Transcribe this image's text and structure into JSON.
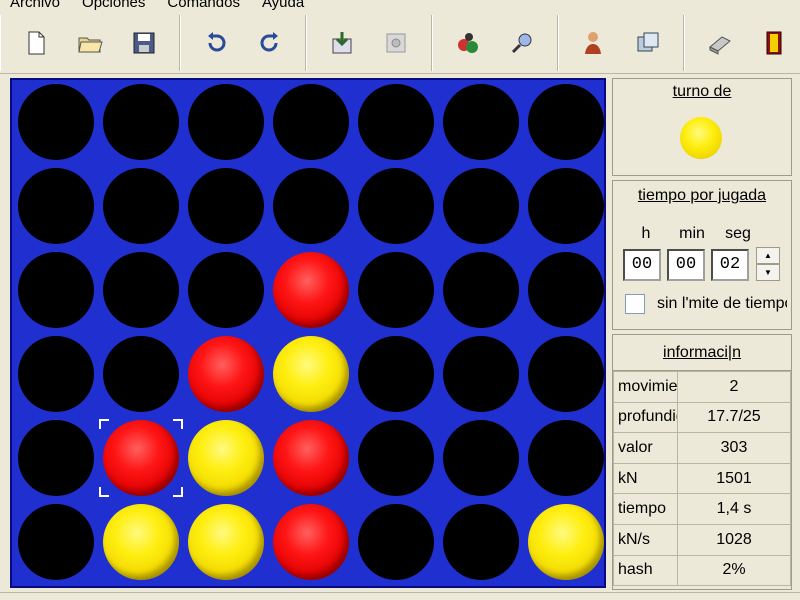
{
  "menu": [
    "Archivo",
    "Opciones",
    "Comandos",
    "Ayuda"
  ],
  "toolbar": [
    [
      "new-file-icon",
      "open-folder-icon",
      "save-icon"
    ],
    [
      "undo-icon",
      "redo-icon"
    ],
    [
      "import-icon",
      "stop-icon"
    ],
    [
      "players-icon",
      "search-icon"
    ],
    [
      "user-icon",
      "windows-icon"
    ],
    [
      "book-icon",
      "exit-icon"
    ]
  ],
  "board": {
    "cols": 7,
    "rows": 6,
    "grid": [
      [
        "empty",
        "empty",
        "empty",
        "empty",
        "empty",
        "empty",
        "empty"
      ],
      [
        "empty",
        "empty",
        "empty",
        "empty",
        "empty",
        "empty",
        "empty"
      ],
      [
        "empty",
        "empty",
        "empty",
        "red",
        "empty",
        "empty",
        "empty"
      ],
      [
        "empty",
        "empty",
        "red",
        "yellow",
        "empty",
        "empty",
        "empty"
      ],
      [
        "empty",
        "red",
        "yellow",
        "red",
        "empty",
        "empty",
        "empty"
      ],
      [
        "empty",
        "yellow",
        "yellow",
        "red",
        "empty",
        "empty",
        "yellow"
      ]
    ],
    "selected": {
      "row": 4,
      "col": 1
    },
    "colors": {
      "board": "#1f2fd0",
      "red": "#ff1515",
      "yellow": "#ffee10"
    }
  },
  "turn": {
    "title": "turno de",
    "player": "yellow"
  },
  "time": {
    "title": "tiempo por jugada",
    "labels": {
      "h": "h",
      "min": "min",
      "seg": "seg"
    },
    "values": {
      "h": "00",
      "min": "00",
      "seg": "02"
    },
    "no_limit_label": "sin l'mite de tiempo",
    "no_limit_checked": false
  },
  "info": {
    "title": "informaci|n",
    "rows": [
      {
        "k": "movimientos",
        "v": "2"
      },
      {
        "k": "profundidad",
        "v": "17.7/25"
      },
      {
        "k": "valor",
        "v": "303"
      },
      {
        "k": "kN",
        "v": "1501"
      },
      {
        "k": "tiempo",
        "v": "1,4 s"
      },
      {
        "k": "kN/s",
        "v": "1028"
      },
      {
        "k": "hash",
        "v": "2%"
      }
    ]
  }
}
